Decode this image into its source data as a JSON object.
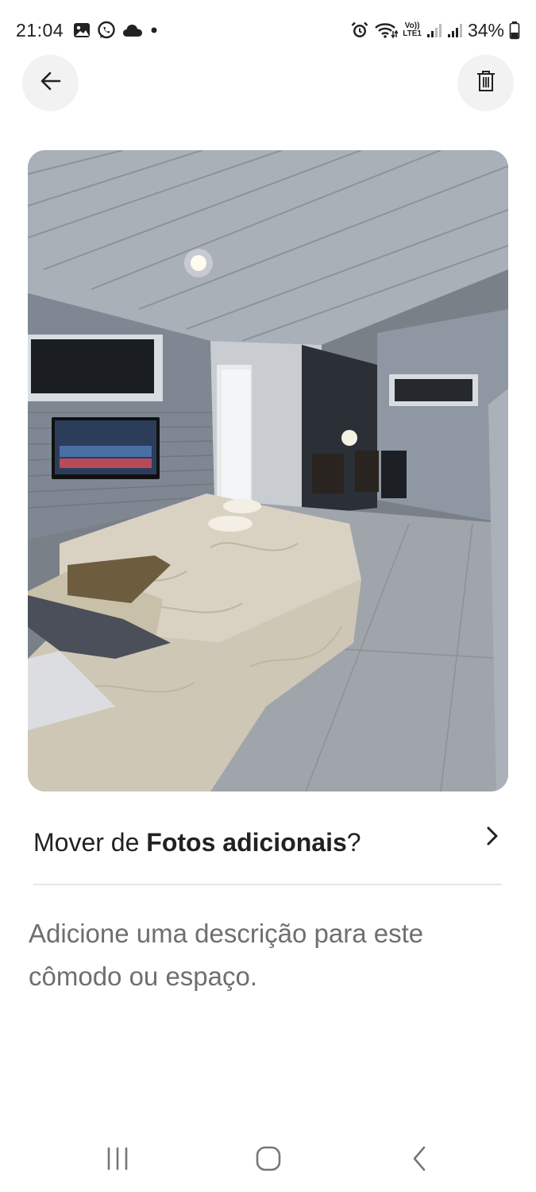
{
  "status_bar": {
    "time": "21:04",
    "left_icons": [
      "gallery-icon",
      "whatsapp-icon",
      "cloud-icon",
      "dot-icon"
    ],
    "right_icons": [
      "alarm-icon",
      "wifi-icon",
      "volte-icon",
      "signal-icon",
      "signal-icon",
      "battery-icon"
    ],
    "volte_label_top": "Vo))",
    "volte_label_bottom": "LTE1",
    "battery": "34%"
  },
  "header": {
    "back_icon": "arrow-left-icon",
    "delete_icon": "trash-icon"
  },
  "photo": {
    "subject": "bedroom photo"
  },
  "move": {
    "prefix": "Mover de ",
    "album": "Fotos adicionais",
    "suffix": "?",
    "icon": "chevron-right-icon"
  },
  "description": {
    "placeholder": "Adicione uma descrição para este cômodo ou espaço."
  },
  "nav": {
    "recents_icon": "recents-icon",
    "home_icon": "home-icon",
    "back_icon": "back-chevron-icon"
  }
}
